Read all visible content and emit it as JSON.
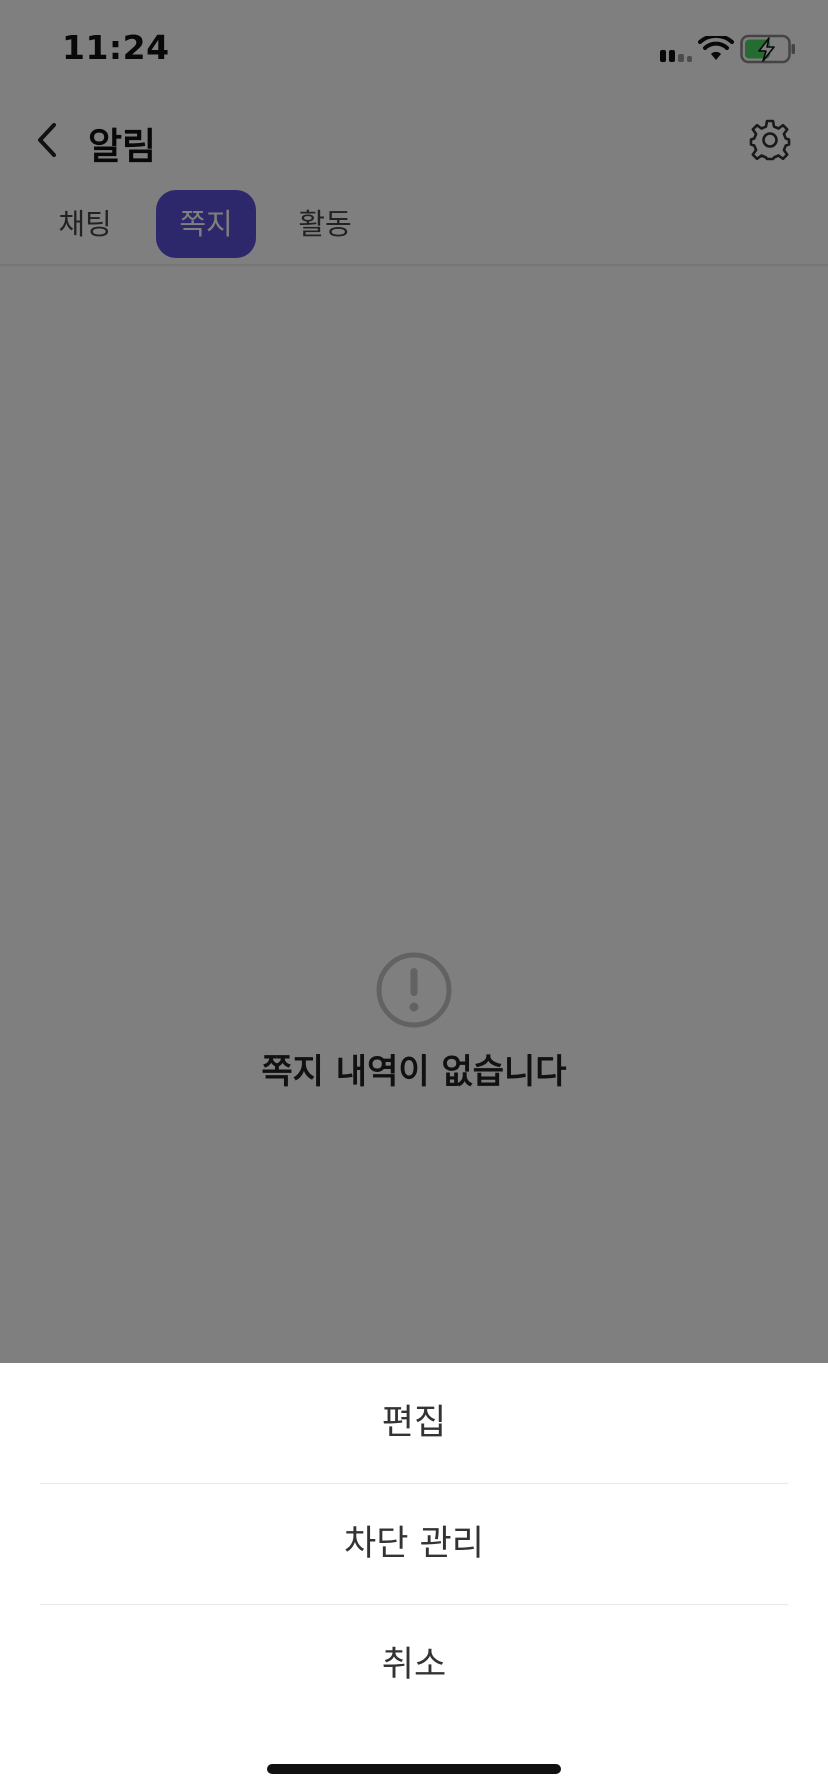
{
  "status_bar": {
    "time": "11:24",
    "icons": [
      "signal-icon",
      "wifi-icon",
      "battery-charging-icon"
    ],
    "battery_color": "#4cd964"
  },
  "header": {
    "title": "알림",
    "back_icon": "chevron-left-icon",
    "settings_icon": "gear-icon"
  },
  "tabs": [
    {
      "label": "채팅",
      "active": false
    },
    {
      "label": "쪽지",
      "active": true
    },
    {
      "label": "활동",
      "active": false
    }
  ],
  "empty_state": {
    "icon": "alert-circle-icon",
    "message": "쪽지 내역이 없습니다"
  },
  "action_sheet": {
    "items": [
      {
        "label": "편집"
      },
      {
        "label": "차단 관리"
      },
      {
        "label": "취소"
      }
    ]
  },
  "colors": {
    "accent": "#5a4fd6",
    "overlay": "rgba(0,0,0,0.5)"
  }
}
